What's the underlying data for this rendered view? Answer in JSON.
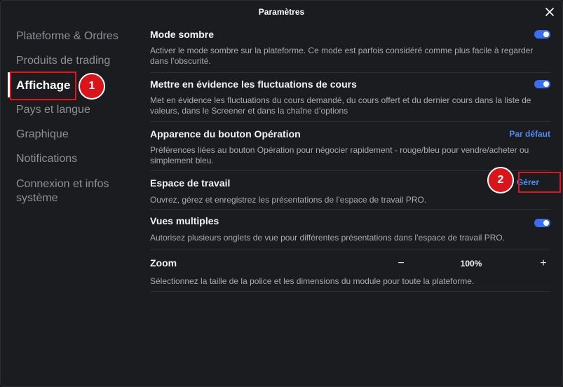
{
  "window": {
    "title": "Paramètres"
  },
  "sidebar": {
    "items": [
      {
        "label": "Plateforme & Ordres"
      },
      {
        "label": "Produits de trading"
      },
      {
        "label": "Affichage"
      },
      {
        "label": "Pays et langue"
      },
      {
        "label": "Graphique"
      },
      {
        "label": "Notifications"
      },
      {
        "label": "Connexion et infos\nsystème"
      }
    ],
    "active_index": 2
  },
  "settings": {
    "dark_mode": {
      "title": "Mode sombre",
      "description": "Activer le mode sombre sur la plateforme. Ce mode est parfois considéré comme plus facile à regarder dans l’obscurité.",
      "enabled": true
    },
    "price_fluctuations": {
      "title": "Mettre en évidence les fluctuations de cours",
      "description": "Met en évidence les fluctuations du cours demandé, du cours offert et du dernier cours dans la liste de valeurs, dans le Screener et dans la chaîne d’options",
      "enabled": true
    },
    "operation_button": {
      "title": "Apparence du bouton Opération",
      "description": "Préférences liées au bouton Opération pour négocier rapidement - rouge/bleu pour vendre/acheter ou simplement bleu.",
      "action_label": "Par défaut"
    },
    "workspace": {
      "title": "Espace de travail",
      "description": "Ouvrez, gérez et enregistrez les présentations de l’espace de travail PRO.",
      "action_label": "Gérer"
    },
    "multiple_views": {
      "title": "Vues multiples",
      "description": "Autorisez plusieurs onglets de vue pour différentes présentations dans l’espace de travail PRO.",
      "enabled": true
    },
    "zoom": {
      "title": "Zoom",
      "description": "Sélectionnez la taille de la police et les dimensions du module pour toute la plateforme.",
      "value": "100%",
      "minus": "−",
      "plus": "+"
    }
  },
  "annotations": [
    {
      "number": "1"
    },
    {
      "number": "2"
    }
  ],
  "colors": {
    "accent": "#3a6ef0",
    "link": "#4d8cf5",
    "annotation": "#e2151b"
  }
}
